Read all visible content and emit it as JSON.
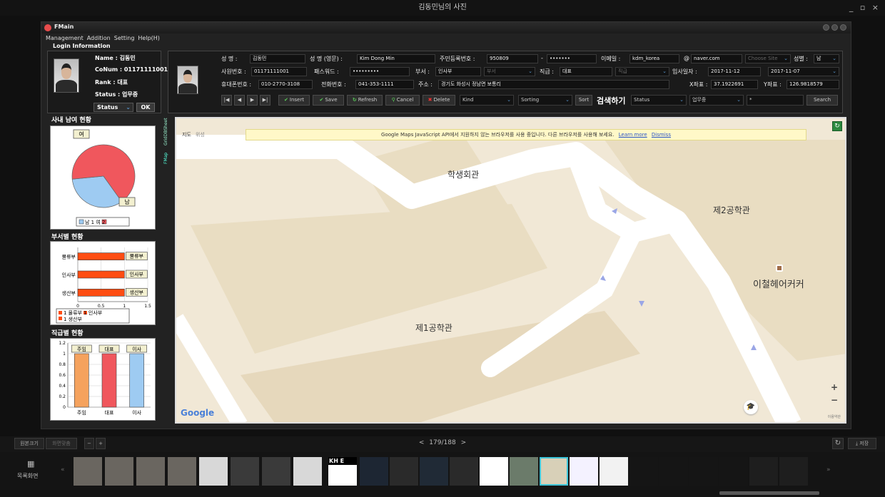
{
  "viewer": {
    "title": "김동민님의 사진",
    "window_controls": "_ ▫ ×",
    "toolbar": {
      "original_size": "원본크기",
      "fit_screen": "화면맞춤",
      "zoom_out": "−",
      "zoom_in": "+",
      "page": "179/188",
      "prev": "<",
      "next": ">",
      "rotate": "↻",
      "save": "⤓ 저장"
    },
    "filmstrip": {
      "list_view_label": "목록화면",
      "prev": "«",
      "next": "»",
      "thumb_text_1": "KH E"
    }
  },
  "app": {
    "title": "FMain",
    "menu": [
      "Management",
      "Addition",
      "Setting",
      "Help(H)"
    ],
    "login_title": "Login Information",
    "login": {
      "name_label": "Name : 김동민",
      "colnum_label": "CoNum : 01171111001",
      "rank_label": "Rank : 대표",
      "status_label": "Status : 업무중",
      "status_select": "Status",
      "ok": "OK"
    },
    "detail": {
      "name_label": "성    명 :",
      "name_value": "김동민",
      "eng_name_label": "성 명 (영문) :",
      "eng_name_value": "Kim Dong Min",
      "ssn_label": "주민등록번호 :",
      "ssn_front": "950809",
      "ssn_sep": "-",
      "ssn_back": "•••••••",
      "email_label": "이메일 :",
      "email_id": "kdm_korea",
      "email_at": "@",
      "email_domain": "naver.com",
      "site_select": "Choose Site",
      "gender_label": "성별 :",
      "gender_value": "남",
      "emp_no_label": "사원번호 :",
      "emp_no_value": "01171111001",
      "password_label": "패스워드 :",
      "password_value": "•••••••••",
      "dept_label": "부서 :",
      "dept_value": "인사부",
      "dept_select": "부서",
      "position_label": "직급 :",
      "position_value": "대표",
      "position_select": "직급",
      "hire_label": "입사일자 :",
      "hire_date_1": "2017-11-12",
      "hire_date_2": "2017-11-07",
      "mobile_label": "휴대폰번호 :",
      "mobile_value": "010-2770-3108",
      "phone_label": "전화번호 :",
      "phone_value": "041-353-1111",
      "address_label": "주소 :",
      "address_value": "경기도 화성시 정남면 보통리",
      "x_label": "X좌표 :",
      "x_value": "37.1922691",
      "y_label": "Y좌표 :",
      "y_value": "126.9818579"
    },
    "nav": {
      "first": "|◀",
      "prev": "◀",
      "next": "▶",
      "last": "▶|",
      "insert": "Insert",
      "save": "Save",
      "refresh": "Refresh",
      "cancel": "Cancel",
      "delete": "Delete",
      "kind": "Kind",
      "sorting": "Sorting",
      "sort": "Sort",
      "search_title": "검색하기",
      "status_field": "Status",
      "status_value": "업무중",
      "search_text": "*",
      "search": "Search"
    },
    "side_tabs": [
      "GridDBSheet",
      "FMap"
    ],
    "gender_panel": {
      "title": "사내 남여 현황",
      "female_label": "여",
      "male_label": "남",
      "legend": "남  1   여  2"
    },
    "dept_panel": {
      "title": "부서별 현황",
      "legend_1": "1 물류부   1 인사부",
      "legend_2": "1 생산부"
    },
    "rank_panel": {
      "title": "직급별 현황"
    },
    "map": {
      "notice": "Google Maps JavaScript API에서 지원하지 않는 브라우저를 사용 중입니다. 다른 브라우저를 사용해 보세요.",
      "learn_more": "Learn more",
      "dismiss": "Dismiss",
      "map_type": "지도",
      "satellite_type": "위성",
      "label_student_hall": "학생회관",
      "label_eng2": "제2공학관",
      "label_eng1": "제1공학관",
      "label_hair": "이철헤어커커",
      "google": "Google",
      "zoom_in": "+",
      "zoom_out": "−",
      "terms": "이용약관",
      "refresh": "↻"
    }
  },
  "colors": {
    "pie_female": "#f0575d",
    "pie_male": "#9ecbf2",
    "bar_dept": "#ff4d12",
    "rank_1": "#f5a25d",
    "rank_2": "#f0575d",
    "rank_3": "#9ecbf2",
    "accent": "#3cc4d8"
  },
  "chart_data": [
    {
      "type": "pie",
      "title": "사내 남여 현황",
      "categories": [
        "남",
        "여"
      ],
      "values": [
        1,
        2
      ]
    },
    {
      "type": "bar",
      "orientation": "horizontal",
      "title": "부서별 현황",
      "categories": [
        "물류부",
        "인사부",
        "생산부"
      ],
      "values": [
        1,
        1,
        1
      ],
      "xticks": [
        "0",
        "0.5",
        "1",
        "1.5"
      ],
      "xlim": [
        0,
        1.5
      ]
    },
    {
      "type": "bar",
      "title": "직급별 현황",
      "categories": [
        "주임",
        "대표",
        "이사"
      ],
      "values": [
        1,
        1,
        1
      ],
      "yticks": [
        "0",
        "0.2",
        "0.4",
        "0.6",
        "0.8",
        "1",
        "1.2"
      ],
      "ylim": [
        0,
        1.2
      ]
    }
  ]
}
